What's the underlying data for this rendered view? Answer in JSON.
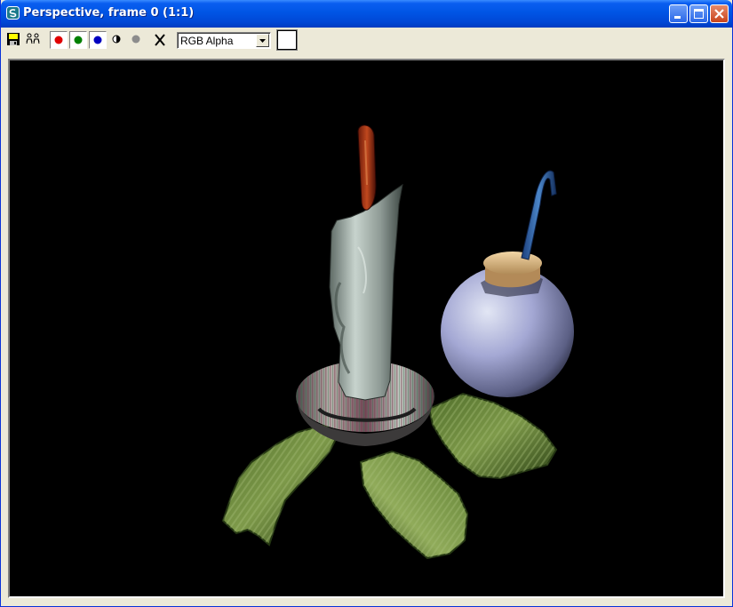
{
  "window": {
    "title": "Perspective, frame 0 (1:1)"
  },
  "titlebar_buttons": {
    "minimize": "minimize-icon",
    "maximize": "maximize-icon",
    "close": "close-icon"
  },
  "toolbar": {
    "save_icon": "save-icon",
    "clone_icon": "clone-icon",
    "red_channel_color": "#e00000",
    "green_channel_color": "#008000",
    "blue_channel_color": "#0000c0",
    "monochrome_icon": "monochrome-icon",
    "alpha_icon": "alpha-icon",
    "clear_icon": "clear-x-icon",
    "channel_display": "RGB Alpha",
    "swatch_color": "#ffffff"
  },
  "render": {
    "background_color": "#000000",
    "objects": [
      "candle",
      "flame",
      "candle-holder",
      "leaves",
      "jar",
      "cork",
      "cane-handle"
    ]
  }
}
